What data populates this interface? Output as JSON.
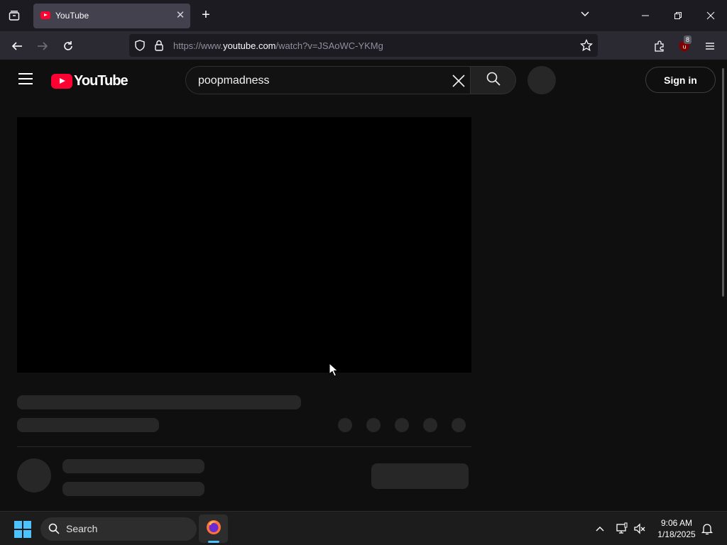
{
  "browser": {
    "tab": {
      "title": "YouTube"
    },
    "url": {
      "prefix": "https://www.",
      "host": "youtube.com",
      "path": "/watch?v=JSAoWC-YKMg"
    },
    "extension_badge": "8"
  },
  "youtube": {
    "logo_text": "YouTube",
    "search_value": "poopmadness",
    "signin_label": "Sign in"
  },
  "taskbar": {
    "search_label": "Search",
    "time": "9:06 AM",
    "date": "1/18/2025"
  },
  "colors": {
    "accent": "#4cc2ff",
    "brand_red": "#ff0033",
    "page_bg": "#0f0f0f"
  }
}
